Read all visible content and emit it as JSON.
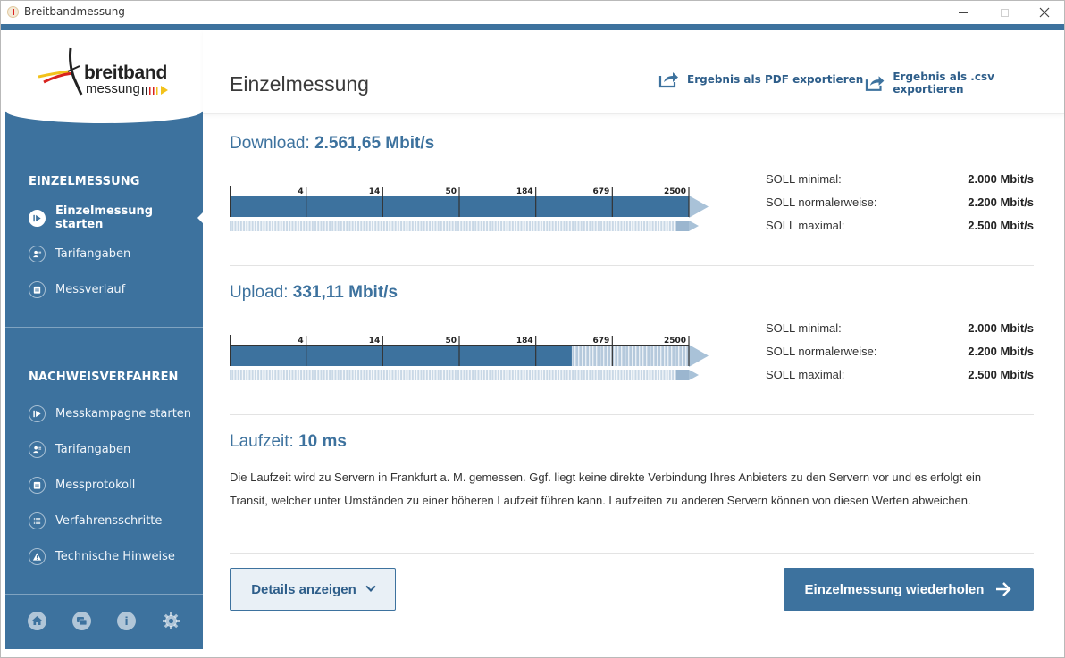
{
  "window": {
    "title": "Breitbandmessung"
  },
  "logo": {
    "line1": "breitband",
    "line2": "messung"
  },
  "sidebar": {
    "section1": "EINZELMESSUNG",
    "section1_items": [
      {
        "label": "Einzelmessung starten",
        "icon": "play-icon",
        "active": true
      },
      {
        "label": "Tarifangaben",
        "icon": "user-tariff-icon"
      },
      {
        "label": "Messverlauf",
        "icon": "calendar-icon"
      }
    ],
    "section2": "NACHWEISVERFAHREN",
    "section2_items": [
      {
        "label": "Messkampagne starten",
        "icon": "play-icon"
      },
      {
        "label": "Tarifangaben",
        "icon": "user-tariff-icon"
      },
      {
        "label": "Messprotokoll",
        "icon": "calendar-icon"
      },
      {
        "label": "Verfahrensschritte",
        "icon": "list-icon"
      },
      {
        "label": "Technische Hinweise",
        "icon": "warning-icon"
      }
    ],
    "footer_icons": [
      "home-icon",
      "chat-icon",
      "info-icon",
      "gear-icon"
    ],
    "info_glyph": "i"
  },
  "header": {
    "title": "Einzelmessung",
    "export_pdf": "Ergebnis als PDF exportieren",
    "export_csv": "Ergebnis als .csv exportieren"
  },
  "download": {
    "label": "Download: ",
    "value": "2.561,65 Mbit/s",
    "fill_fraction": 1.0,
    "soll": [
      {
        "label": "SOLL minimal:",
        "value": "2.000 Mbit/s"
      },
      {
        "label": "SOLL normalerweise:",
        "value": "2.200 Mbit/s"
      },
      {
        "label": "SOLL maximal:",
        "value": "2.500 Mbit/s"
      }
    ]
  },
  "upload": {
    "label": "Upload: ",
    "value": "331,11 Mbit/s",
    "fill_fraction": 0.745,
    "soll": [
      {
        "label": "SOLL minimal:",
        "value": "2.000 Mbit/s"
      },
      {
        "label": "SOLL normalerweise:",
        "value": "2.200 Mbit/s"
      },
      {
        "label": "SOLL maximal:",
        "value": "2.500 Mbit/s"
      }
    ]
  },
  "scale_ticks": [
    "4",
    "14",
    "50",
    "184",
    "679",
    "2500"
  ],
  "latency": {
    "label": "Laufzeit: ",
    "value": "10 ms",
    "text_line1": "Die Laufzeit wird zu Servern in Frankfurt a. M. gemessen. Ggf. liegt keine direkte Verbindung Ihres Anbieters zu den Servern vor und es erfolgt ein",
    "text_line2": "Transit, welcher unter Umständen zu einer höheren Laufzeit führen kann. Laufzeiten zu anderen Servern können von diesen Werten abweichen."
  },
  "buttons": {
    "details": "Details anzeigen",
    "repeat": "Einzelmessung wiederholen"
  },
  "colors": {
    "primary": "#3d729e",
    "light_bar": "#b5c9dc"
  }
}
